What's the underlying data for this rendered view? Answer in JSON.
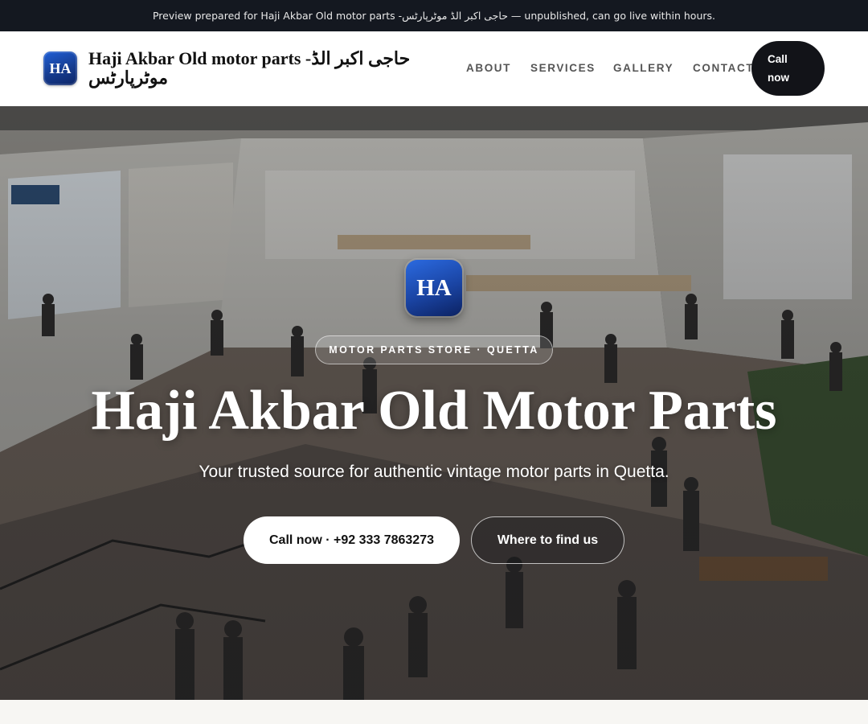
{
  "preview_bar": {
    "text": "Preview prepared for Haji Akbar Old motor parts -حاجی اکبر الڈ موٹرپارٹس — unpublished, can go live within hours."
  },
  "header": {
    "logo_initials": "HA",
    "brand_name": "Haji Akbar Old motor parts -حاجی اکبر الڈ موٹرپارٹس",
    "nav": {
      "about": "ABOUT",
      "services": "SERVICES",
      "gallery": "GALLERY",
      "contact": "CONTACT"
    },
    "call_button": "Call now"
  },
  "hero": {
    "logo_initials": "HA",
    "badge": "MOTOR PARTS STORE · QUETTA",
    "title": "Haji Akbar Old Motor Parts",
    "subtitle": "Your trusted source for authentic vintage motor parts in Quetta.",
    "primary_button": "Call now · +92 333 7863273",
    "secondary_button": "Where to find us"
  },
  "colors": {
    "preview_bar_bg": "#141820",
    "header_bg": "#ffffff",
    "dark_button": "#121318",
    "logo_blue": "#1a44a3",
    "page_bg": "#f7f6f3"
  }
}
